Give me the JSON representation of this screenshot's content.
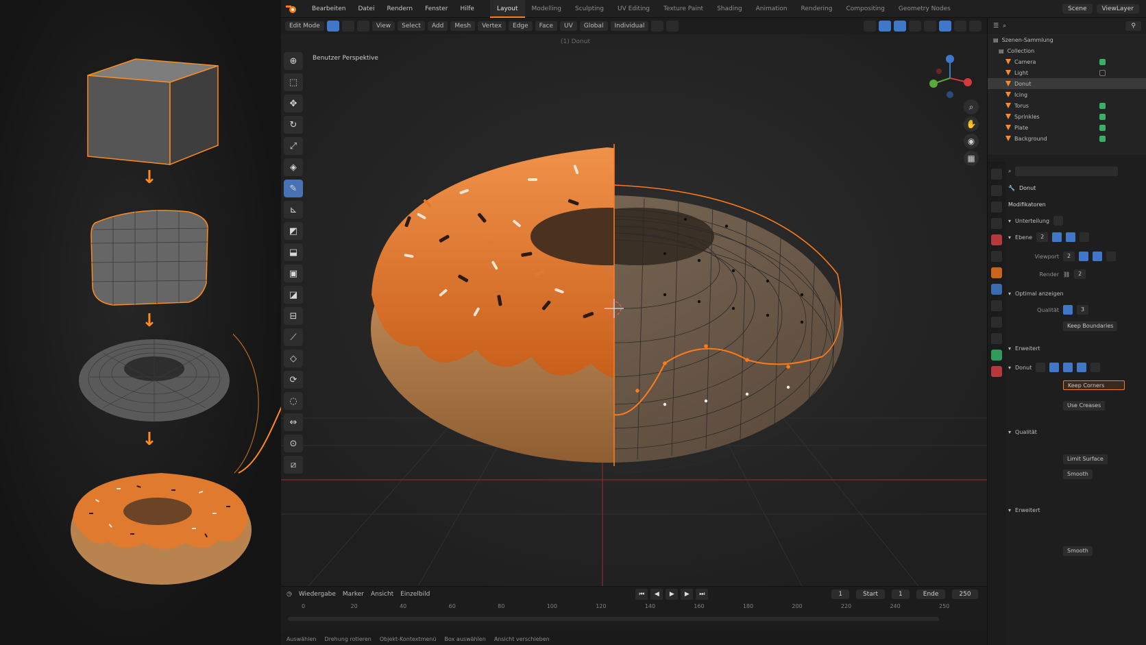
{
  "topbar": {
    "menus": [
      "Bearbeiten",
      "Datei",
      "Rendern",
      "Fenster",
      "Hilfe"
    ],
    "workspaces": [
      "Layout",
      "Modelling",
      "Sculpting",
      "UV Editing",
      "Texture Paint",
      "Shading",
      "Animation",
      "Rendering",
      "Compositing",
      "Geometry Nodes"
    ],
    "active_workspace": 0,
    "scene": "Scene",
    "view_layer": "ViewLayer"
  },
  "viewport_header": {
    "mode": "Edit Mode",
    "menus": [
      "View",
      "Select",
      "Add",
      "Mesh",
      "Vertex",
      "Edge",
      "Face",
      "UV"
    ],
    "transform": "Global",
    "pivot": "Individual"
  },
  "viewport": {
    "mode_label": "Benutzer Perspektive",
    "view_label": "(1) Donut",
    "tool_icons": [
      "cursor-icon",
      "select-box-icon",
      "move-icon",
      "rotate-icon",
      "scale-icon",
      "transform-icon",
      "annotate-icon",
      "measure-icon",
      "add-cube-icon",
      "extrude-icon",
      "inset-icon",
      "bevel-icon",
      "loop-cut-icon",
      "knife-icon",
      "poly-build-icon",
      "spin-icon",
      "smooth-icon",
      "edge-slide-icon",
      "shrink-icon",
      "shear-icon",
      "rip-icon"
    ],
    "active_tool": 7
  },
  "pipeline": {
    "stages": [
      "cube",
      "subdivided-cube",
      "torus",
      "donut"
    ]
  },
  "timeline": {
    "menus": [
      "Wiedergabe",
      "Marker",
      "Ansicht",
      "Einzelbild"
    ],
    "current_frame": "1",
    "start_label": "Start",
    "start": "1",
    "end_label": "Ende",
    "end": "250",
    "ticks": [
      "0",
      "20",
      "40",
      "60",
      "80",
      "100",
      "120",
      "140",
      "160",
      "180",
      "200",
      "220",
      "240",
      "250"
    ],
    "status": [
      "Auswählen",
      "Drehung rotieren",
      "Objekt-Kontextmenü",
      "Box auswählen",
      "Ansicht verschieben"
    ]
  },
  "outliner": {
    "title": "Szenen-Sammlung",
    "collection": "Collection",
    "items": [
      "Camera",
      "Light",
      "Donut",
      "Icing",
      "Torus",
      "Sprinkles",
      "Plate",
      "Background"
    ],
    "selected_item": 2
  },
  "properties": {
    "object_name": "Donut",
    "sections": [
      "Modifikatoren",
      "Unterteilung",
      "Ebene",
      "Viewport",
      "Render",
      "Optimal anzeigen",
      "Erweitert",
      "Qualität"
    ],
    "fields": {
      "levels_viewport": "2",
      "render": "2",
      "quality": "3",
      "uv_smooth": "Keep Boundaries",
      "boundary": "Keep Corners",
      "crease": "Use Creases",
      "limit": "Limit Surface",
      "smooth": "Smooth"
    }
  },
  "colors": {
    "accent": "#ff7a1a",
    "select_blue": "#3f78c9",
    "icing": "#e07a2e",
    "dough": "#c98e55",
    "viewport_bg": "#262626"
  }
}
